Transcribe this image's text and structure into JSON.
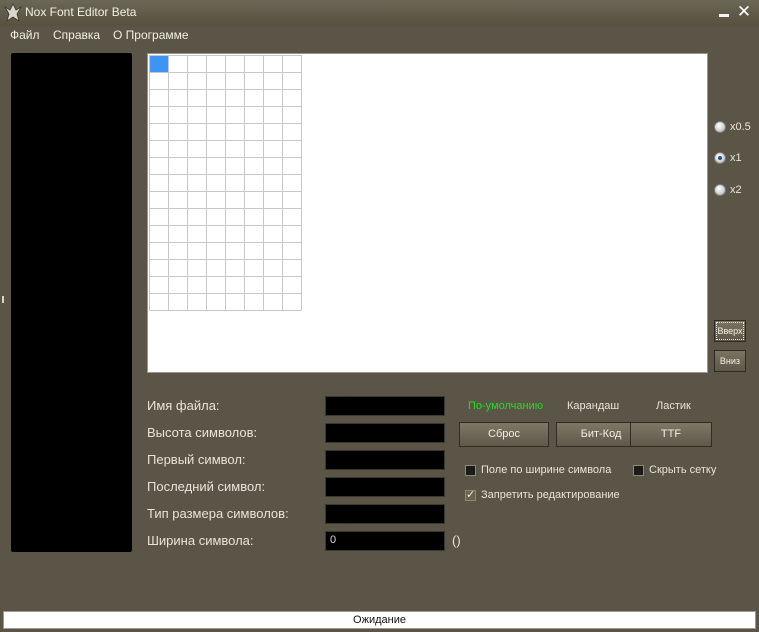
{
  "window": {
    "title": "Nox Font Editor Beta",
    "minimize_icon": "minimize-icon",
    "close_icon": "close-icon",
    "close_glyph": "✕"
  },
  "menu": {
    "items": [
      {
        "label": "Файл"
      },
      {
        "label": "Справка"
      },
      {
        "label": "О Программе"
      }
    ]
  },
  "editor": {
    "grid": {
      "columns": 8,
      "rows": 15
    },
    "selected_cell": {
      "column": 1,
      "row": 1
    }
  },
  "zoom": {
    "options": [
      {
        "label": "x0.5",
        "checked": false
      },
      {
        "label": "x1",
        "checked": true
      },
      {
        "label": "x2",
        "checked": false
      }
    ]
  },
  "navigation": {
    "up_label": "Вверх",
    "down_label": "Вниз"
  },
  "form": {
    "file_name_label": "Имя файла:",
    "file_name_value": "",
    "char_height_label": "Высота символов:",
    "char_height_value": "",
    "first_char_label": "Первый символ:",
    "first_char_value": "",
    "last_char_label": "Последний символ:",
    "last_char_value": "",
    "size_type_label": "Тип размера символов:",
    "size_type_value": "",
    "char_width_label": "Ширина символа:",
    "char_width_value": "0",
    "char_width_suffix": "()"
  },
  "modes": {
    "default_label": "По-умолчанию",
    "pencil_label": "Карандаш",
    "eraser_label": "Ластик",
    "active_color": "#22dd22"
  },
  "actions": {
    "reset_label": "Сброс",
    "bitcode_label": "Бит-Код",
    "ttf_label": "TTF"
  },
  "options": {
    "field_by_width_label": "Поле по ширине символа",
    "field_by_width_checked": false,
    "hide_grid_label": "Скрыть сетку",
    "hide_grid_checked": false,
    "lock_editing_label": "Запретить редактирование",
    "lock_editing_checked": true
  },
  "status": {
    "text": "Ожидание"
  },
  "colors": {
    "window_bg": "#5a5546",
    "selected_cell": "#3c95f5",
    "panel": "#000000"
  }
}
